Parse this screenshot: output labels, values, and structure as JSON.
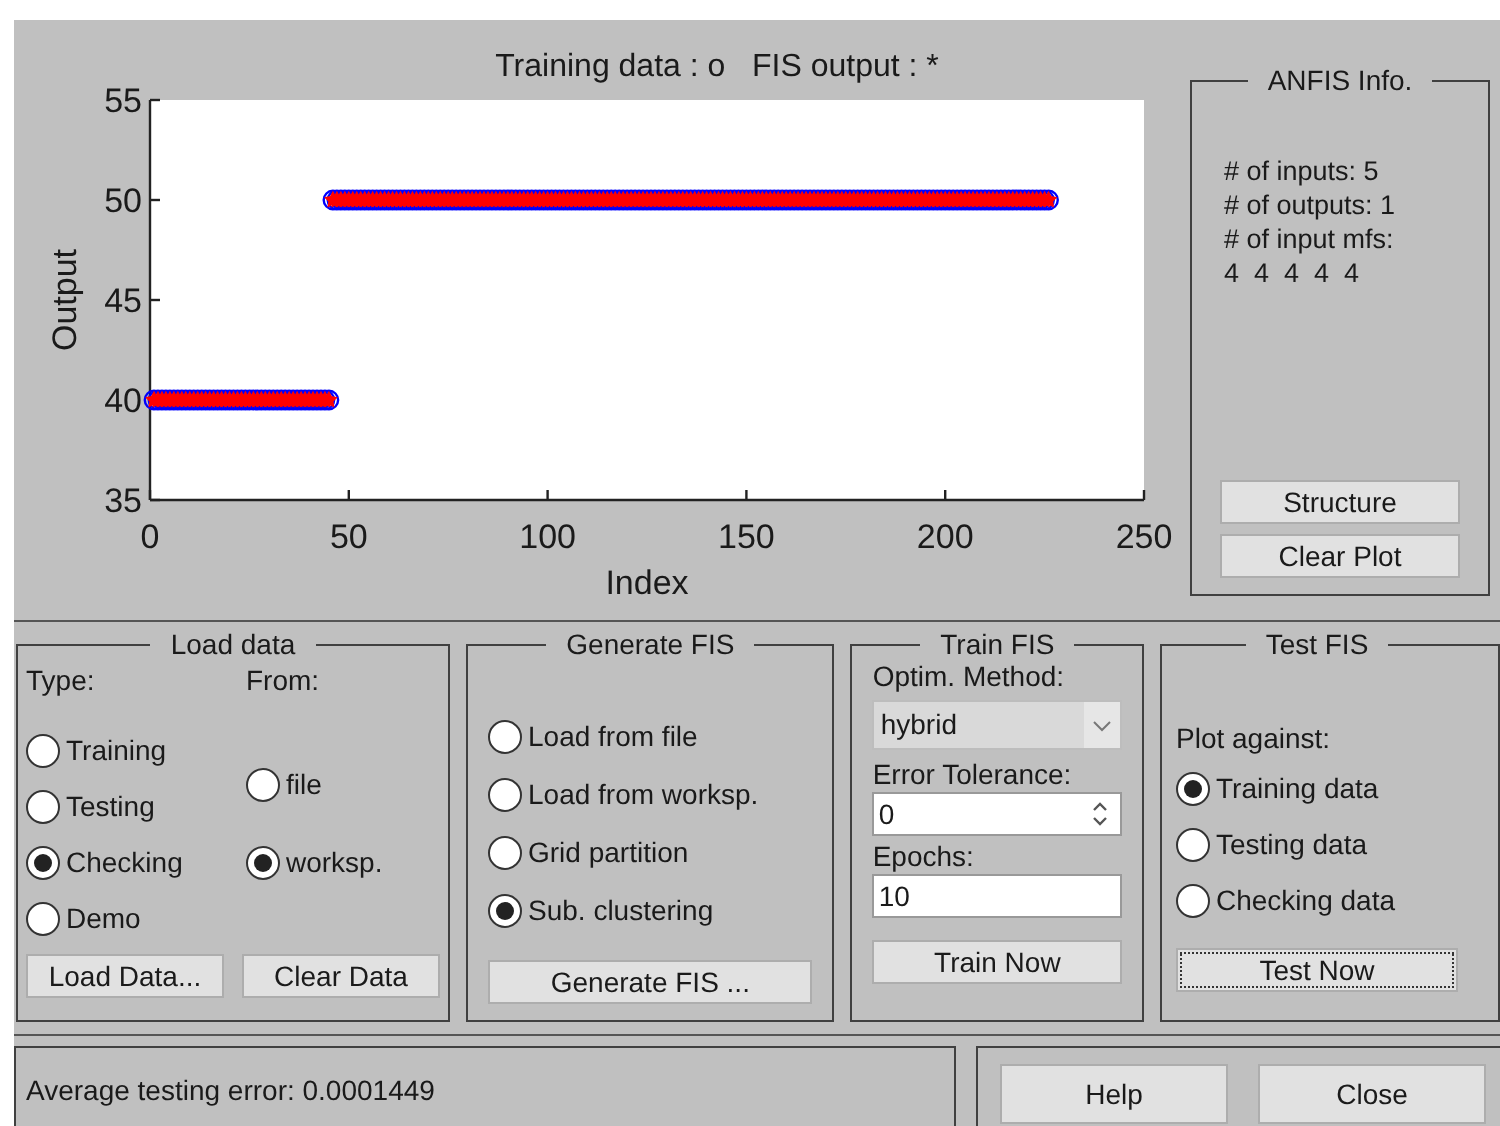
{
  "plot": {
    "chart_data": {
      "type": "scatter",
      "xlabel": "Index",
      "ylabel": "Output",
      "xlim": [
        0,
        250
      ],
      "ylim": [
        35,
        55
      ],
      "xticks": [
        0,
        50,
        100,
        150,
        200,
        250
      ],
      "yticks": [
        35,
        40,
        45,
        50,
        55
      ],
      "x": [
        1,
        2,
        3,
        4,
        5,
        6,
        7,
        8,
        9,
        10,
        11,
        12,
        13,
        14,
        15,
        16,
        17,
        18,
        19,
        20,
        21,
        22,
        23,
        24,
        25,
        26,
        27,
        28,
        29,
        30,
        31,
        32,
        33,
        34,
        35,
        36,
        37,
        38,
        39,
        40,
        41,
        42,
        43,
        44,
        45,
        46,
        47,
        48,
        49,
        50,
        51,
        52,
        53,
        54,
        55,
        56,
        57,
        58,
        59,
        60,
        61,
        62,
        63,
        64,
        65,
        66,
        67,
        68,
        69,
        70,
        71,
        72,
        73,
        74,
        75,
        76,
        77,
        78,
        79,
        80,
        81,
        82,
        83,
        84,
        85,
        86,
        87,
        88,
        89,
        90,
        91,
        92,
        93,
        94,
        95,
        96,
        97,
        98,
        99,
        100,
        101,
        102,
        103,
        104,
        105,
        106,
        107,
        108,
        109,
        110,
        111,
        112,
        113,
        114,
        115,
        116,
        117,
        118,
        119,
        120,
        121,
        122,
        123,
        124,
        125,
        126,
        127,
        128,
        129,
        130,
        131,
        132,
        133,
        134,
        135,
        136,
        137,
        138,
        139,
        140,
        141,
        142,
        143,
        144,
        145,
        146,
        147,
        148,
        149,
        150,
        151,
        152,
        153,
        154,
        155,
        156,
        157,
        158,
        159,
        160,
        161,
        162,
        163,
        164,
        165,
        166,
        167,
        168,
        169,
        170,
        171,
        172,
        173,
        174,
        175,
        176,
        177,
        178,
        179,
        180,
        181,
        182,
        183,
        184,
        185,
        186,
        187,
        188,
        189,
        190,
        191,
        192,
        193,
        194,
        195,
        196,
        197,
        198,
        199,
        200,
        201,
        202,
        203,
        204,
        205,
        206,
        207,
        208,
        209,
        210,
        211,
        212,
        213,
        214,
        215,
        216,
        217,
        218,
        219,
        220,
        221,
        222,
        223,
        224,
        225,
        226
      ],
      "series": [
        {
          "name": "Training data : o",
          "marker": "circle",
          "color": "#0000ff",
          "values": [
            40,
            40,
            40,
            40,
            40,
            40,
            40,
            40,
            40,
            40,
            40,
            40,
            40,
            40,
            40,
            40,
            40,
            40,
            40,
            40,
            40,
            40,
            40,
            40,
            40,
            40,
            40,
            40,
            40,
            40,
            40,
            40,
            40,
            40,
            40,
            40,
            40,
            40,
            40,
            40,
            40,
            40,
            40,
            40,
            40,
            50,
            50,
            50,
            50,
            50,
            50,
            50,
            50,
            50,
            50,
            50,
            50,
            50,
            50,
            50,
            50,
            50,
            50,
            50,
            50,
            50,
            50,
            50,
            50,
            50,
            50,
            50,
            50,
            50,
            50,
            50,
            50,
            50,
            50,
            50,
            50,
            50,
            50,
            50,
            50,
            50,
            50,
            50,
            50,
            50,
            50,
            50,
            50,
            50,
            50,
            50,
            50,
            50,
            50,
            50,
            50,
            50,
            50,
            50,
            50,
            50,
            50,
            50,
            50,
            50,
            50,
            50,
            50,
            50,
            50,
            50,
            50,
            50,
            50,
            50,
            50,
            50,
            50,
            50,
            50,
            50,
            50,
            50,
            50,
            50,
            50,
            50,
            50,
            50,
            50,
            50,
            50,
            50,
            50,
            50,
            50,
            50,
            50,
            50,
            50,
            50,
            50,
            50,
            50,
            50,
            50,
            50,
            50,
            50,
            50,
            50,
            50,
            50,
            50,
            50,
            50,
            50,
            50,
            50,
            50,
            50,
            50,
            50,
            50,
            50,
            50,
            50,
            50,
            50,
            50,
            50,
            50,
            50,
            50,
            50,
            50,
            50,
            50,
            50,
            50,
            50,
            50,
            50,
            50,
            50,
            50,
            50,
            50,
            50,
            50,
            50,
            50,
            50,
            50,
            50,
            50,
            50,
            50,
            50,
            50,
            50,
            50,
            50,
            50,
            50,
            50,
            50,
            50,
            50,
            50,
            50,
            50,
            50,
            50,
            50,
            50,
            50,
            50,
            50,
            50,
            50
          ]
        },
        {
          "name": "FIS output : *",
          "marker": "star",
          "color": "#ff0000",
          "values": [
            40,
            40,
            40,
            40,
            40,
            40,
            40,
            40,
            40,
            40,
            40,
            40,
            40,
            40,
            40,
            40,
            40,
            40,
            40,
            40,
            40,
            40,
            40,
            40,
            40,
            40,
            40,
            40,
            40,
            40,
            40,
            40,
            40,
            40,
            40,
            40,
            40,
            40,
            40,
            40,
            40,
            40,
            40,
            40,
            40,
            50,
            50,
            50,
            50,
            50,
            50,
            50,
            50,
            50,
            50,
            50,
            50,
            50,
            50,
            50,
            50,
            50,
            50,
            50,
            50,
            50,
            50,
            50,
            50,
            50,
            50,
            50,
            50,
            50,
            50,
            50,
            50,
            50,
            50,
            50,
            50,
            50,
            50,
            50,
            50,
            50,
            50,
            50,
            50,
            50,
            50,
            50,
            50,
            50,
            50,
            50,
            50,
            50,
            50,
            50,
            50,
            50,
            50,
            50,
            50,
            50,
            50,
            50,
            50,
            50,
            50,
            50,
            50,
            50,
            50,
            50,
            50,
            50,
            50,
            50,
            50,
            50,
            50,
            50,
            50,
            50,
            50,
            50,
            50,
            50,
            50,
            50,
            50,
            50,
            50,
            50,
            50,
            50,
            50,
            50,
            50,
            50,
            50,
            50,
            50,
            50,
            50,
            50,
            50,
            50,
            50,
            50,
            50,
            50,
            50,
            50,
            50,
            50,
            50,
            50,
            50,
            50,
            50,
            50,
            50,
            50,
            50,
            50,
            50,
            50,
            50,
            50,
            50,
            50,
            50,
            50,
            50,
            50,
            50,
            50,
            50,
            50,
            50,
            50,
            50,
            50,
            50,
            50,
            50,
            50,
            50,
            50,
            50,
            50,
            50,
            50,
            50,
            50,
            50,
            50,
            50,
            50,
            50,
            50,
            50,
            50,
            50,
            50,
            50,
            50,
            50,
            50,
            50,
            50,
            50,
            50,
            50,
            50,
            50,
            50,
            50,
            50,
            50,
            50,
            50,
            50
          ]
        }
      ]
    }
  },
  "anfis_info": {
    "title": "ANFIS Info.",
    "lines": [
      "# of inputs: 5",
      "# of outputs: 1",
      "# of input mfs:",
      "4  4  4  4  4"
    ],
    "buttons": [
      "Structure",
      "Clear Plot"
    ]
  },
  "load_data": {
    "title": "Load data",
    "type_label": "Type:",
    "from_label": "From:",
    "type_options": [
      {
        "label": "Training",
        "selected": false
      },
      {
        "label": "Testing",
        "selected": false
      },
      {
        "label": "Checking",
        "selected": true
      },
      {
        "label": "Demo",
        "selected": false
      }
    ],
    "from_options": [
      {
        "label": "file",
        "selected": false
      },
      {
        "label": "worksp.",
        "selected": true
      }
    ],
    "buttons": [
      "Load Data...",
      "Clear Data"
    ]
  },
  "generate_fis": {
    "title": "Generate FIS",
    "options": [
      {
        "label": "Load from file",
        "selected": false
      },
      {
        "label": "Load from worksp.",
        "selected": false
      },
      {
        "label": "Grid partition",
        "selected": false
      },
      {
        "label": "Sub. clustering",
        "selected": true
      }
    ],
    "button": "Generate FIS ..."
  },
  "train_fis": {
    "title": "Train FIS",
    "method_label": "Optim. Method:",
    "method": "hybrid",
    "tolerance_label": "Error Tolerance:",
    "tolerance": "0",
    "epochs_label": "Epochs:",
    "epochs": "10",
    "button": "Train Now"
  },
  "test_fis": {
    "title": "Test FIS",
    "plot_against_label": "Plot against:",
    "options": [
      {
        "label": "Training data",
        "selected": true
      },
      {
        "label": "Testing data",
        "selected": false
      },
      {
        "label": "Checking data",
        "selected": false
      }
    ],
    "button": {
      "label": "Test Now",
      "focused": true
    }
  },
  "status_bar": {
    "message": "Average testing error: 0.0001449",
    "buttons": [
      "Help",
      "Close"
    ]
  }
}
